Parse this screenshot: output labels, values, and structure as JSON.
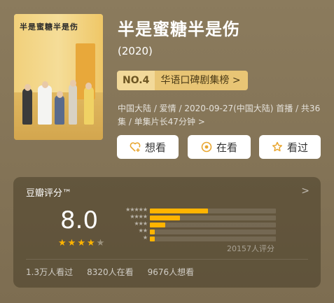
{
  "movie": {
    "poster_title": "半是蜜糖半是伤",
    "title": "半是蜜糖半是伤",
    "year": "(2020)",
    "rank": {
      "no": "NO.4",
      "name": "华语口碑剧集榜 >"
    },
    "meta": "中国大陆 / 爱情 / 2020-09-27(中国大陆) 首播 / 共36集 / 单集片长47分钟 >"
  },
  "actions": {
    "want_label": "想看",
    "watching_label": "在看",
    "watched_label": "看过"
  },
  "rating": {
    "brand": "豆瓣评分™",
    "chevron": ">",
    "score": "8.0",
    "stars_filled": 4,
    "stars_total": 5,
    "distribution": {
      "star_labels": [
        "★★★★★",
        "★★★★",
        "★★★",
        "★★",
        "★"
      ],
      "fractions": [
        0.46,
        0.24,
        0.12,
        0.04,
        0.04
      ]
    },
    "count": "20157人评分",
    "stats": {
      "watched": "1.3万人看过",
      "watching": "8320人在看",
      "want": "9676人想看"
    }
  },
  "colors": {
    "background": "#8a7a5c",
    "star": "#ffb400",
    "rank_badge": "#e8c575"
  }
}
